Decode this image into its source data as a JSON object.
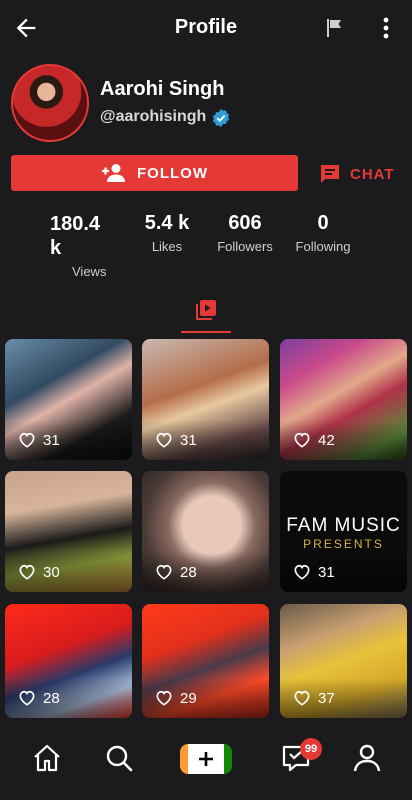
{
  "header": {
    "title": "Profile"
  },
  "profile": {
    "name": "Aarohi Singh",
    "handle": "@aarohisingh",
    "follow_label": "FOLLOW",
    "chat_label": "CHAT"
  },
  "stats": [
    {
      "value": "180.4\nk",
      "label": "Views"
    },
    {
      "value": "5.4 k",
      "label": "Likes"
    },
    {
      "value": "606",
      "label": "Followers"
    },
    {
      "value": "0",
      "label": "Following"
    }
  ],
  "videos": [
    {
      "likes": "31"
    },
    {
      "likes": "31"
    },
    {
      "likes": "42"
    },
    {
      "likes": "30"
    },
    {
      "likes": "28"
    },
    {
      "likes": "31",
      "title_line1": "FAM MUSIC",
      "title_line2": "PRESENTS"
    },
    {
      "likes": "28"
    },
    {
      "likes": "29"
    },
    {
      "likes": "37"
    }
  ],
  "nav": {
    "notification_count": "99"
  },
  "colors": {
    "accent": "#e53935",
    "background": "#1b1b1d",
    "verified": "#2d9cdb"
  }
}
